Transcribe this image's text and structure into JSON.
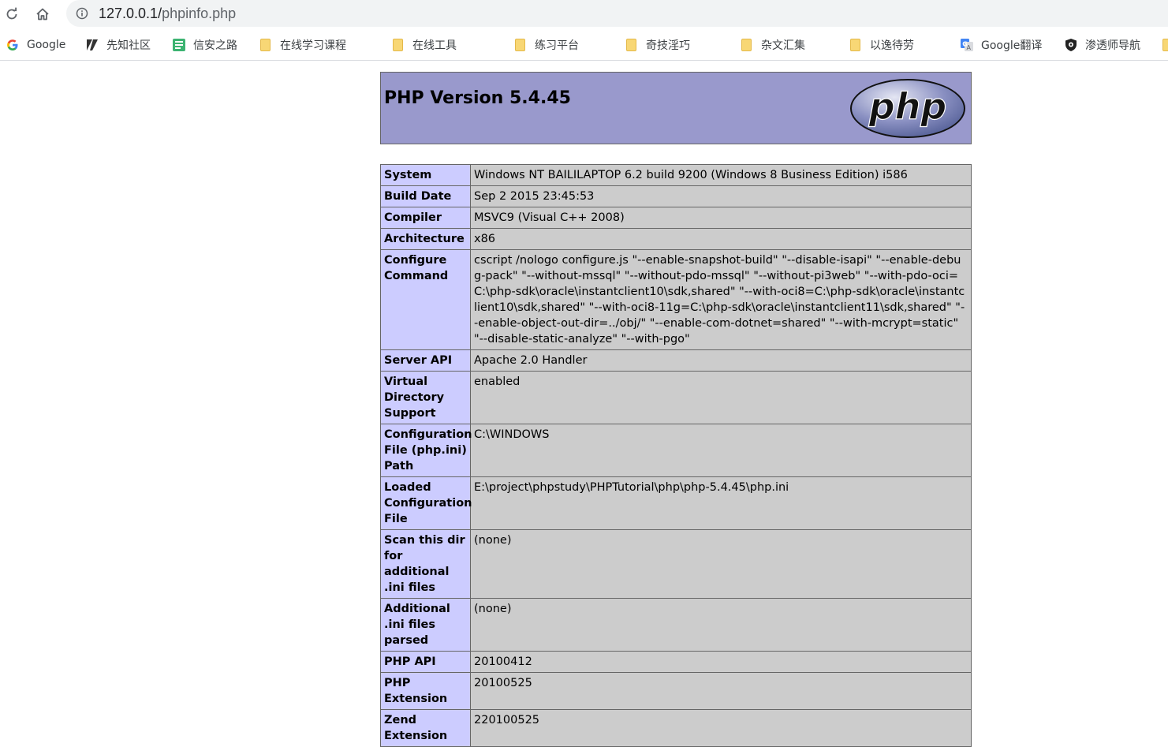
{
  "browser": {
    "url_host": "127.0.0.1/",
    "url_path": "phpinfo.php",
    "bookmarks": [
      {
        "label": "Google",
        "icon": "google-icon"
      },
      {
        "label": "先知社区",
        "icon": "xianzhi-icon"
      },
      {
        "label": "信安之路",
        "icon": "xinan-icon"
      },
      {
        "label": "在线学习课程",
        "icon": "folder-icon"
      },
      {
        "label": "在线工具",
        "icon": "folder-icon"
      },
      {
        "label": "练习平台",
        "icon": "folder-icon"
      },
      {
        "label": "奇技淫巧",
        "icon": "folder-icon"
      },
      {
        "label": "杂文汇集",
        "icon": "folder-icon"
      },
      {
        "label": "以逸待劳",
        "icon": "folder-icon"
      },
      {
        "label": "Google翻译",
        "icon": "google-translate-icon"
      },
      {
        "label": "渗透师导航",
        "icon": "shield-icon"
      }
    ]
  },
  "php": {
    "title": "PHP Version 5.4.45",
    "logo_text": "php",
    "rows": [
      {
        "key": "System",
        "value": "Windows NT BAILILAPTOP 6.2 build 9200 (Windows 8 Business Edition) i586"
      },
      {
        "key": "Build Date",
        "value": "Sep 2 2015 23:45:53"
      },
      {
        "key": "Compiler",
        "value": "MSVC9 (Visual C++ 2008)"
      },
      {
        "key": "Architecture",
        "value": "x86"
      },
      {
        "key": "Configure Command",
        "value": "cscript /nologo configure.js \"--enable-snapshot-build\" \"--disable-isapi\" \"--enable-debug-pack\" \"--without-mssql\" \"--without-pdo-mssql\" \"--without-pi3web\" \"--with-pdo-oci=C:\\php-sdk\\oracle\\instantclient10\\sdk,shared\" \"--with-oci8=C:\\php-sdk\\oracle\\instantclient10\\sdk,shared\" \"--with-oci8-11g=C:\\php-sdk\\oracle\\instantclient11\\sdk,shared\" \"--enable-object-out-dir=../obj/\" \"--enable-com-dotnet=shared\" \"--with-mcrypt=static\" \"--disable-static-analyze\" \"--with-pgo\""
      },
      {
        "key": "Server API",
        "value": "Apache 2.0 Handler"
      },
      {
        "key": "Virtual Directory Support",
        "value": "enabled"
      },
      {
        "key": "Configuration File (php.ini) Path",
        "value": "C:\\WINDOWS"
      },
      {
        "key": "Loaded Configuration File",
        "value": "E:\\project\\phpstudy\\PHPTutorial\\php\\php-5.4.45\\php.ini"
      },
      {
        "key": "Scan this dir for additional .ini files",
        "value": "(none)"
      },
      {
        "key": "Additional .ini files parsed",
        "value": "(none)"
      },
      {
        "key": "PHP API",
        "value": "20100412"
      },
      {
        "key": "PHP Extension",
        "value": "20100525"
      },
      {
        "key": "Zend Extension",
        "value": "220100525"
      }
    ]
  },
  "colors": {
    "header_bg": "#9999cc",
    "key_bg": "#ccccff",
    "value_bg": "#cccccc",
    "border": "#666666"
  }
}
